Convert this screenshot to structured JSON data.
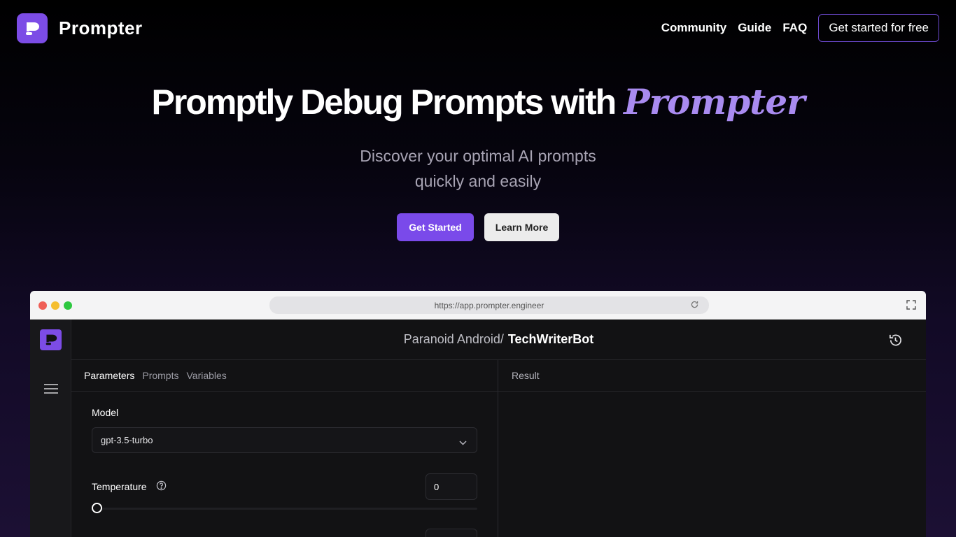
{
  "brand": {
    "name": "Prompter",
    "logo_icon": "speech-bubble-icon"
  },
  "nav": {
    "links": [
      "Community",
      "Guide",
      "FAQ"
    ],
    "cta": "Get started for free"
  },
  "hero": {
    "title_main": "Promptly Debug Prompts with",
    "title_accent": "Prompter",
    "subtitle_line1": "Discover your optimal AI prompts",
    "subtitle_line2": "quickly and easily",
    "primary_button": "Get Started",
    "secondary_button": "Learn More"
  },
  "colors": {
    "accent": "#7a4aea",
    "accent_text": "#a98bf0",
    "background": "#000000"
  },
  "mockup": {
    "url": "https://app.prompter.engineer",
    "breadcrumb_prefix": "Paranoid Android/",
    "breadcrumb_name": "TechWriterBot",
    "tabs": [
      "Parameters",
      "Prompts",
      "Variables"
    ],
    "active_tab": "Parameters",
    "result_label": "Result",
    "model_label": "Model",
    "model_value": "gpt-3.5-turbo",
    "temperature_label": "Temperature",
    "temperature_value": "0",
    "temperature_slider_fraction": 0
  }
}
